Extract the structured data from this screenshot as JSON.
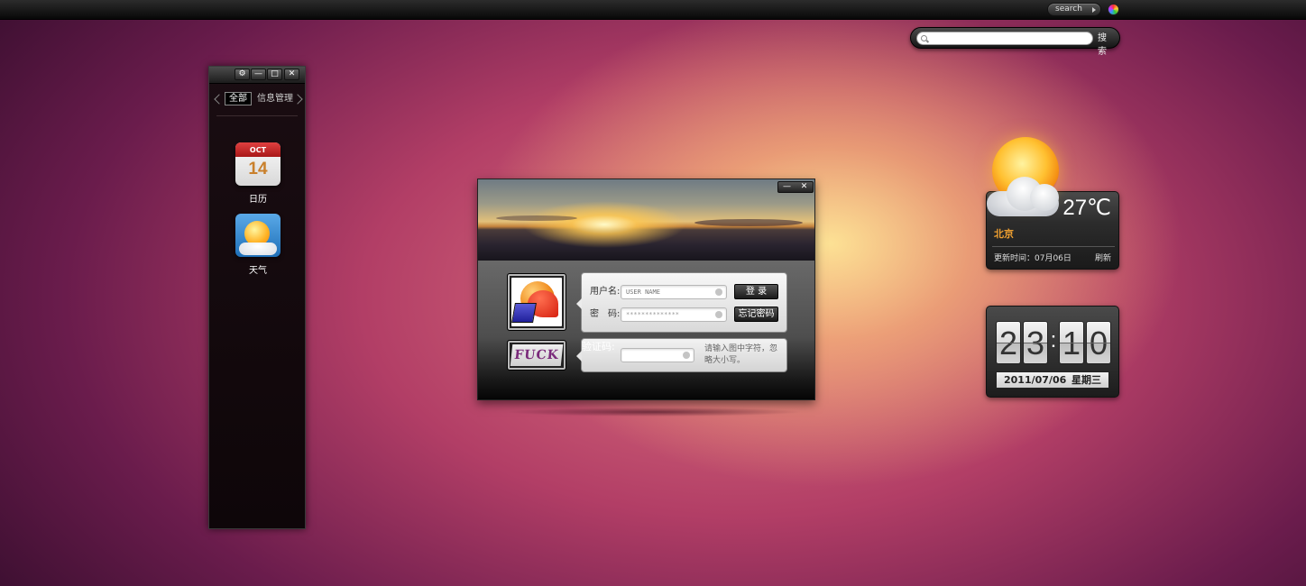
{
  "topbar": {
    "search_label": "search"
  },
  "search": {
    "value": "",
    "button_label": "搜 索"
  },
  "app_panel": {
    "controls": {
      "settings": "⚙",
      "minimize": "—",
      "maximize": "□",
      "close": "✕"
    },
    "tabs": [
      {
        "label": "全部",
        "active": true
      },
      {
        "label": "信息管理",
        "active": false
      }
    ],
    "apps": [
      {
        "name": "日历",
        "icon": "calendar-icon",
        "month": "OCT",
        "day": "14"
      },
      {
        "name": "天气",
        "icon": "weather-icon"
      }
    ]
  },
  "login": {
    "controls": {
      "minimize": "—",
      "close": "✕"
    },
    "username_label": "用户名:",
    "username_placeholder": "USER NAME",
    "password_label": "密　码:",
    "password_value": "**************",
    "captcha_label": "验证码:",
    "captcha_value": "",
    "captcha_text": "FUCK",
    "captcha_hint": "请输入图中字符，忽略大小写。",
    "login_button": "登 录",
    "forgot_button": "忘记密码"
  },
  "weather": {
    "temperature": "27℃",
    "city": "北京",
    "updated": "更新时间：07月06日",
    "refresh_label": "刷新",
    "icon": "partly-cloudy-icon"
  },
  "clock": {
    "h1": "2",
    "h2": "3",
    "separator": ":",
    "m1": "1",
    "m2": "0",
    "date": "2011/07/06",
    "weekday": "星期三"
  },
  "colors": {
    "city": "#f0a030",
    "accent_orange": "#f08a1c"
  }
}
